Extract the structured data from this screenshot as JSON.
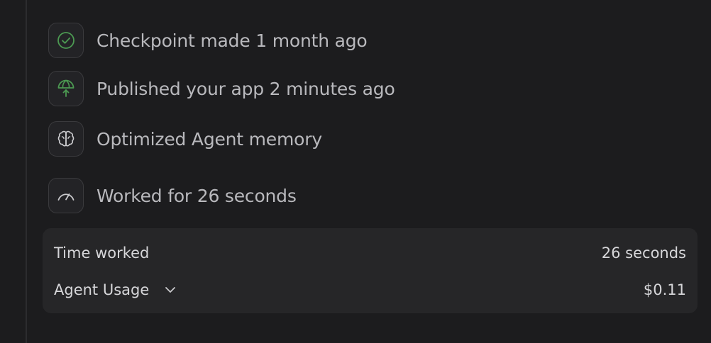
{
  "events": [
    {
      "icon": "checkpoint-check-icon",
      "text": "Checkpoint made 1 month ago"
    },
    {
      "icon": "publish-globe-icon",
      "text": "Published your app 2 minutes ago"
    },
    {
      "icon": "brain-icon",
      "text": "Optimized Agent memory"
    },
    {
      "icon": "speedometer-icon",
      "text": "Worked for 26 seconds"
    }
  ],
  "summary": {
    "time_worked_label": "Time worked",
    "time_worked_value": "26 seconds",
    "agent_usage_label": "Agent Usage",
    "agent_usage_value": "$0.11",
    "agent_usage_toggle_icon": "chevron-down-icon"
  },
  "colors": {
    "background": "#1c1c1e",
    "panel": "#262628",
    "accent_green": "#4c9a52",
    "text": "#b9b9bd"
  }
}
